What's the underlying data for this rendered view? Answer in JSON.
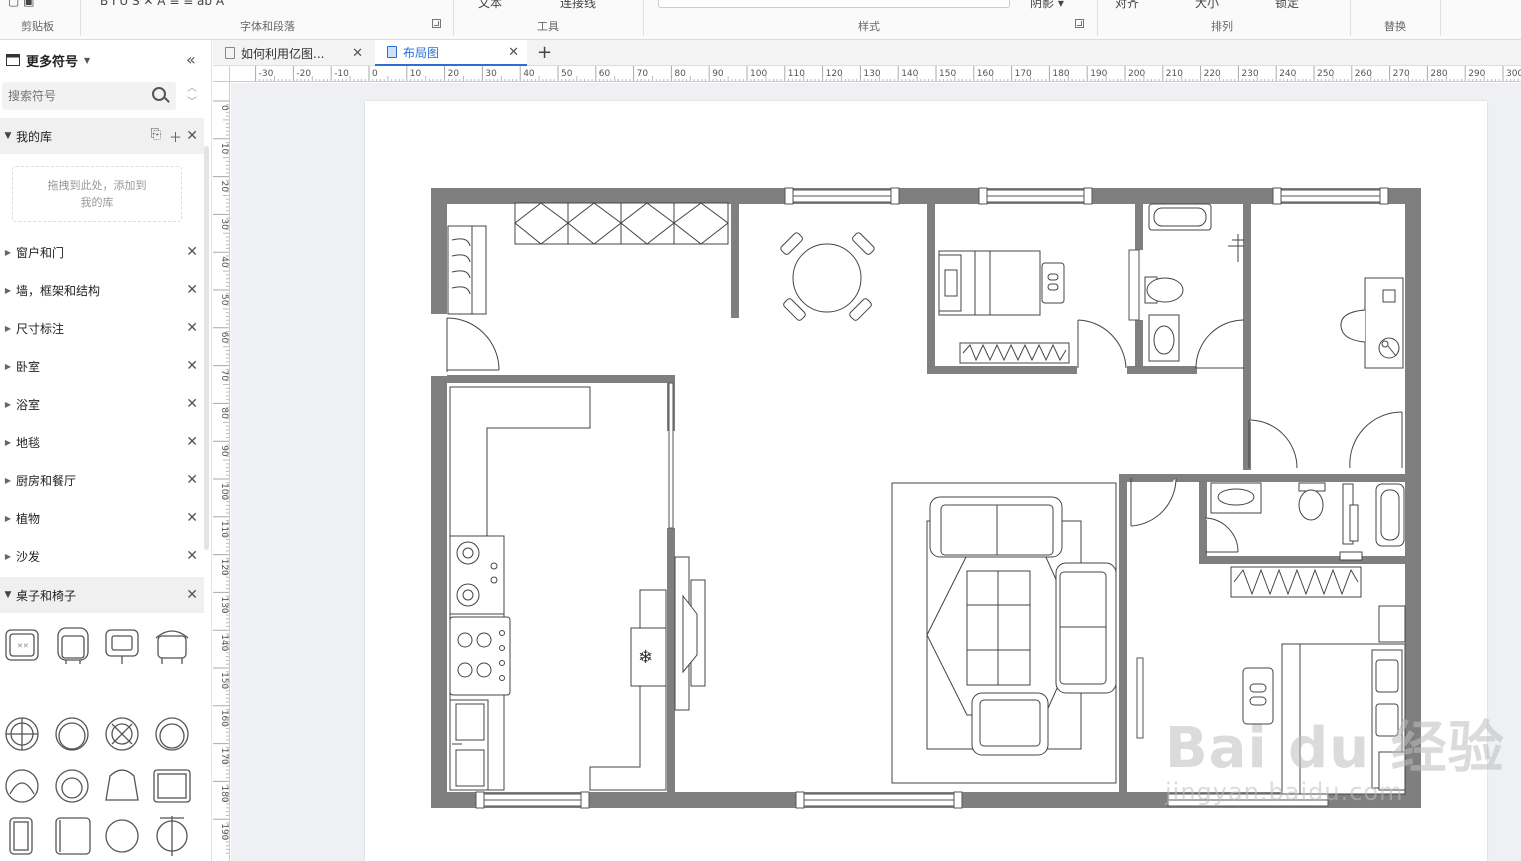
{
  "ribbon": {
    "groups": [
      {
        "label": "剪贴板"
      },
      {
        "label": "字体和段落"
      },
      {
        "label": "工具"
      },
      {
        "label": "样式"
      },
      {
        "label": "排列"
      },
      {
        "label": "替换"
      }
    ],
    "peek": {
      "text_tool": "文本",
      "connector_tool": "连接线",
      "shadow": "阴影",
      "align": "对齐",
      "size": "大小",
      "lock": "锁定"
    }
  },
  "sidebar": {
    "title": "更多符号",
    "search_placeholder": "搜索符号",
    "my_library": {
      "label": "我的库",
      "drop_hint": "拖拽到此处，添加到我的库"
    },
    "categories": [
      {
        "label": "窗户和门"
      },
      {
        "label": "墙，框架和结构"
      },
      {
        "label": "尺寸标注"
      },
      {
        "label": "卧室"
      },
      {
        "label": "浴室"
      },
      {
        "label": "地毯"
      },
      {
        "label": "厨房和餐厅"
      },
      {
        "label": "植物"
      },
      {
        "label": "沙发"
      }
    ],
    "open_category": {
      "label": "桌子和椅子"
    }
  },
  "tabs": [
    {
      "label": "如何利用亿图..."
    },
    {
      "label": "布局图",
      "active": true
    }
  ],
  "ruler": {
    "top_ticks": [
      "-30",
      "-20",
      "-10",
      "0",
      "10",
      "20",
      "30",
      "40",
      "50",
      "60",
      "70",
      "80",
      "90",
      "100",
      "110",
      "120",
      "130",
      "140",
      "150",
      "160",
      "170",
      "180",
      "190",
      "200",
      "210",
      "220",
      "230",
      "240",
      "250",
      "260",
      "270",
      "280",
      "290",
      "300"
    ],
    "left_ticks": [
      "0",
      "10",
      "20",
      "30",
      "40",
      "50",
      "60",
      "70",
      "80",
      "90",
      "100",
      "110",
      "120",
      "130",
      "140",
      "150",
      "160",
      "170",
      "180",
      "190"
    ]
  },
  "watermark": {
    "brand": "Bai du 经验",
    "url": "jingyan.baidu.com"
  },
  "colors": {
    "wall": "#7f7f7f",
    "accent": "#2a6fd6",
    "canvas_bg": "#eef0f4"
  }
}
